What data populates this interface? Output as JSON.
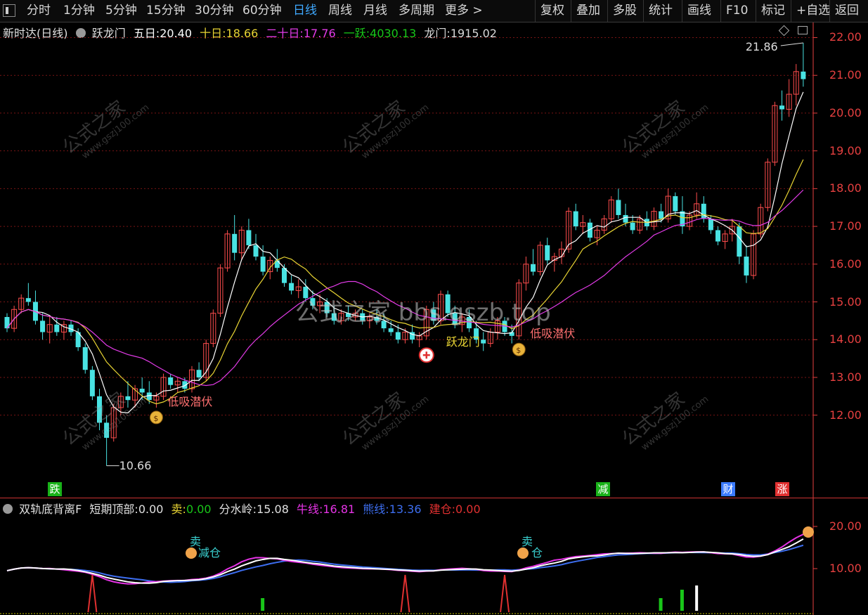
{
  "toolbar": {
    "periods": [
      "分时",
      "1分钟",
      "5分钟",
      "15分钟",
      "30分钟",
      "60分钟",
      "日线",
      "周线",
      "月线",
      "多周期",
      "更多 >"
    ],
    "active_period": "日线",
    "actions": [
      "复权",
      "叠加",
      "多股",
      "统计",
      "画线",
      "F10",
      "标记",
      "+自选",
      "返回"
    ]
  },
  "main_header": {
    "stock_title": "新时达(日线)",
    "indicator_name": "跃龙门",
    "ma5_label": "五日:",
    "ma5_value": "20.40",
    "ma10_label": "十日:",
    "ma10_value": "18.66",
    "ma20_label": "二十日:",
    "ma20_value": "17.76",
    "yiyue_label": "一跃:",
    "yiyue_value": "4030.13",
    "longmen_label": "龙门:",
    "longmen_value": "1915.02"
  },
  "main_axis": [
    "22.00",
    "21.00",
    "20.00",
    "19.00",
    "18.00",
    "17.00",
    "16.00",
    "15.00",
    "14.00",
    "13.00",
    "12.00"
  ],
  "annotations": {
    "high_price": "21.86",
    "low_price": "10.66",
    "signal_low_absorb": "低吸潜伏",
    "signal_yuelong": "跃龙门",
    "watermark_center": "公式之家 bbs.gszb.top",
    "watermark_small": "公式之家",
    "watermark_url": "www.gszj100.com"
  },
  "event_tags": [
    {
      "label": "跌",
      "color": "#19b219"
    },
    {
      "label": "减",
      "color": "#19b219"
    },
    {
      "label": "财",
      "color": "#3b7bff"
    },
    {
      "label": "涨",
      "color": "#e03030"
    }
  ],
  "sub_header": {
    "indicator_name": "双轨底背离F",
    "top_label": "短期顶部:",
    "top_value": "0.00",
    "sell_label": "卖:",
    "sell_value": "0.00",
    "water_label": "分水岭:",
    "water_value": "15.08",
    "bull_label": "牛线:",
    "bull_value": "16.81",
    "bear_label": "熊线:",
    "bear_value": "13.36",
    "build_label": "建仓:",
    "build_value": "0.00"
  },
  "sub_axis": [
    "20.00",
    "10.00"
  ],
  "sub_signals": {
    "sell": "卖",
    "reduce": "减仓",
    "reduce2": "仓"
  },
  "colors": {
    "up": "#ff4d4d",
    "down": "#49e3e3",
    "ma5": "#ffffff",
    "ma10": "#e8d433",
    "ma20": "#e33be8",
    "axis": "#e64040",
    "bull": "#e633e6",
    "bear": "#3d6ef0",
    "mid": "#ffffff"
  },
  "chart_data": {
    "type": "candlestick",
    "title": "新时达(日线)",
    "ylim": [
      10.3,
      22.4
    ],
    "candles": [
      [
        14.6,
        14.7,
        14.2,
        14.3
      ],
      [
        14.3,
        14.9,
        14.2,
        14.8
      ],
      [
        14.8,
        15.2,
        14.7,
        15.1
      ],
      [
        15.1,
        15.5,
        14.9,
        15.0
      ],
      [
        15.0,
        15.3,
        14.4,
        14.5
      ],
      [
        14.5,
        14.7,
        14.0,
        14.2
      ],
      [
        14.2,
        14.6,
        13.9,
        14.4
      ],
      [
        14.4,
        14.6,
        14.1,
        14.2
      ],
      [
        14.2,
        14.5,
        14.0,
        14.4
      ],
      [
        14.4,
        14.5,
        14.1,
        14.2
      ],
      [
        14.2,
        14.3,
        13.7,
        13.8
      ],
      [
        13.8,
        13.9,
        13.1,
        13.2
      ],
      [
        13.2,
        13.3,
        12.4,
        12.5
      ],
      [
        12.5,
        12.7,
        11.6,
        11.8
      ],
      [
        11.8,
        12.0,
        10.66,
        11.4
      ],
      [
        11.4,
        12.3,
        11.3,
        12.2
      ],
      [
        12.2,
        12.6,
        12.0,
        12.5
      ],
      [
        12.5,
        12.9,
        12.2,
        12.4
      ],
      [
        12.4,
        12.8,
        12.2,
        12.7
      ],
      [
        12.7,
        13.0,
        12.4,
        12.6
      ],
      [
        12.6,
        12.9,
        12.3,
        12.4
      ],
      [
        12.4,
        12.6,
        12.2,
        12.5
      ],
      [
        12.5,
        13.1,
        12.4,
        13.0
      ],
      [
        13.0,
        13.1,
        12.7,
        12.8
      ],
      [
        12.8,
        13.0,
        12.6,
        12.9
      ],
      [
        12.9,
        13.0,
        12.6,
        12.7
      ],
      [
        12.7,
        13.3,
        12.6,
        13.2
      ],
      [
        13.2,
        13.4,
        12.9,
        13.0
      ],
      [
        13.0,
        14.0,
        12.9,
        13.9
      ],
      [
        13.9,
        14.8,
        13.8,
        14.7
      ],
      [
        14.7,
        16.0,
        14.6,
        15.9
      ],
      [
        15.9,
        16.9,
        15.8,
        16.8
      ],
      [
        16.8,
        17.3,
        16.1,
        16.3
      ],
      [
        16.3,
        17.0,
        16.1,
        16.9
      ],
      [
        16.9,
        17.2,
        16.4,
        16.5
      ],
      [
        16.5,
        16.8,
        16.1,
        16.2
      ],
      [
        16.2,
        16.5,
        15.7,
        15.8
      ],
      [
        15.8,
        16.2,
        15.6,
        16.1
      ],
      [
        16.1,
        16.4,
        15.8,
        15.9
      ],
      [
        15.9,
        16.0,
        15.4,
        15.5
      ],
      [
        15.5,
        15.7,
        15.2,
        15.3
      ],
      [
        15.3,
        15.6,
        15.1,
        15.4
      ],
      [
        15.4,
        15.6,
        15.0,
        15.1
      ],
      [
        15.1,
        15.3,
        14.8,
        14.9
      ],
      [
        14.9,
        15.2,
        14.7,
        15.0
      ],
      [
        15.0,
        15.1,
        14.6,
        14.7
      ],
      [
        14.7,
        14.9,
        14.4,
        14.5
      ],
      [
        14.5,
        14.8,
        14.4,
        14.7
      ],
      [
        14.7,
        14.9,
        14.5,
        14.6
      ],
      [
        14.6,
        14.8,
        14.5,
        14.7
      ],
      [
        14.7,
        14.8,
        14.4,
        14.5
      ],
      [
        14.5,
        14.7,
        14.3,
        14.6
      ],
      [
        14.6,
        14.8,
        14.4,
        14.5
      ],
      [
        14.5,
        14.7,
        14.2,
        14.3
      ],
      [
        14.3,
        14.5,
        14.1,
        14.2
      ],
      [
        14.2,
        14.4,
        13.9,
        14.0
      ],
      [
        14.0,
        14.3,
        13.9,
        14.2
      ],
      [
        14.2,
        14.4,
        13.9,
        14.0
      ],
      [
        14.0,
        14.2,
        13.8,
        14.1
      ],
      [
        14.1,
        14.9,
        14.0,
        14.8
      ],
      [
        14.8,
        15.0,
        14.4,
        14.5
      ],
      [
        14.5,
        15.3,
        14.4,
        15.2
      ],
      [
        15.2,
        15.3,
        14.6,
        14.7
      ],
      [
        14.7,
        14.9,
        14.3,
        14.4
      ],
      [
        14.4,
        14.7,
        14.2,
        14.6
      ],
      [
        14.6,
        14.8,
        14.2,
        14.3
      ],
      [
        14.3,
        14.5,
        13.9,
        14.0
      ],
      [
        14.0,
        14.2,
        13.7,
        13.9
      ],
      [
        13.9,
        14.3,
        13.8,
        14.2
      ],
      [
        14.2,
        14.6,
        14.0,
        14.5
      ],
      [
        14.5,
        14.6,
        14.1,
        14.2
      ],
      [
        14.2,
        14.4,
        13.9,
        14.1
      ],
      [
        14.1,
        15.6,
        14.0,
        15.5
      ],
      [
        15.5,
        16.2,
        15.3,
        16.0
      ],
      [
        16.0,
        16.4,
        15.7,
        15.8
      ],
      [
        15.8,
        16.6,
        15.7,
        16.5
      ],
      [
        16.5,
        16.7,
        16.0,
        16.1
      ],
      [
        16.1,
        16.3,
        15.8,
        16.2
      ],
      [
        16.2,
        16.6,
        16.0,
        16.4
      ],
      [
        16.4,
        17.5,
        16.3,
        17.4
      ],
      [
        17.4,
        17.6,
        16.9,
        17.0
      ],
      [
        17.0,
        17.3,
        16.8,
        17.1
      ],
      [
        17.1,
        17.2,
        16.6,
        16.7
      ],
      [
        16.7,
        17.0,
        16.5,
        16.9
      ],
      [
        16.9,
        17.3,
        16.8,
        17.2
      ],
      [
        17.2,
        17.8,
        17.1,
        17.7
      ],
      [
        17.7,
        18.0,
        17.2,
        17.3
      ],
      [
        17.3,
        17.6,
        17.0,
        17.1
      ],
      [
        17.1,
        17.3,
        16.8,
        16.9
      ],
      [
        16.9,
        17.3,
        16.8,
        17.2
      ],
      [
        17.2,
        17.4,
        16.9,
        17.0
      ],
      [
        17.0,
        17.5,
        16.9,
        17.4
      ],
      [
        17.4,
        17.6,
        17.1,
        17.2
      ],
      [
        17.2,
        18.0,
        17.1,
        17.8
      ],
      [
        17.8,
        17.9,
        17.3,
        17.4
      ],
      [
        17.4,
        17.8,
        16.8,
        17.0
      ],
      [
        17.0,
        17.4,
        16.9,
        17.3
      ],
      [
        17.3,
        17.9,
        17.2,
        17.6
      ],
      [
        17.6,
        17.8,
        17.1,
        17.2
      ],
      [
        17.2,
        17.3,
        16.8,
        16.9
      ],
      [
        16.9,
        17.0,
        16.5,
        16.6
      ],
      [
        16.6,
        16.9,
        16.4,
        16.8
      ],
      [
        16.8,
        17.2,
        16.6,
        17.0
      ],
      [
        17.0,
        17.1,
        16.0,
        16.2
      ],
      [
        16.2,
        16.5,
        15.5,
        15.7
      ],
      [
        15.7,
        16.9,
        15.6,
        16.8
      ],
      [
        16.8,
        17.6,
        16.7,
        17.5
      ],
      [
        17.5,
        18.8,
        17.4,
        18.7
      ],
      [
        18.7,
        20.3,
        18.6,
        20.2
      ],
      [
        20.2,
        20.6,
        19.8,
        20.1
      ],
      [
        20.1,
        20.9,
        19.9,
        20.5
      ],
      [
        20.5,
        21.3,
        20.2,
        21.1
      ],
      [
        21.1,
        21.86,
        20.7,
        20.9
      ]
    ],
    "high_point": 21.86,
    "low_point": 10.66
  }
}
